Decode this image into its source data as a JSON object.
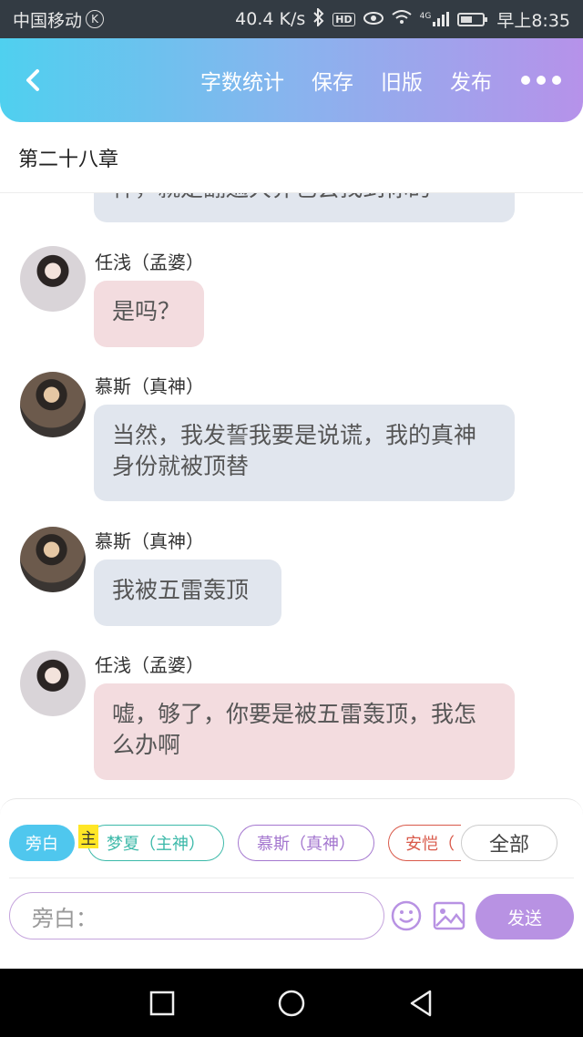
{
  "status_bar": {
    "carrier": "中国移动",
    "speed": "40.4 K/s",
    "network": "4G",
    "time": "早上8:35",
    "hd_badge": "HD",
    "icons": [
      "k-badge-icon",
      "bluetooth-icon",
      "hd-icon",
      "eye-icon",
      "wifi-icon",
      "signal-icon",
      "battery-icon"
    ]
  },
  "header": {
    "actions": [
      "字数统计",
      "保存",
      "旧版",
      "发布"
    ],
    "gradient_colors": [
      "#4fd0ef",
      "#b692ea"
    ]
  },
  "chapter": {
    "title": "第二十八章"
  },
  "messages": [
    {
      "speaker": "",
      "text": "神，就是翻遍大界也会找到你的",
      "style": "blue",
      "partial": true
    },
    {
      "speaker": "任浅（孟婆）",
      "text": "是吗？",
      "style": "pink",
      "avatar": "girl-avatar"
    },
    {
      "speaker": "慕斯（真神）",
      "text": "当然，我发誓我要是说谎，我的真神身份就被顶替",
      "style": "blue",
      "avatar": "boy-avatar"
    },
    {
      "speaker": "慕斯（真神）",
      "text": "我被五雷轰顶",
      "style": "blue",
      "avatar": "boy-avatar"
    },
    {
      "speaker": "任浅（孟婆）",
      "text": "嘘，够了，你要是被五雷轰顶，我怎么办啊",
      "style": "pink",
      "avatar": "girl-avatar"
    }
  ],
  "roles": {
    "narrator": "旁白",
    "main_tag": "主",
    "chips": [
      "梦夏（主神）",
      "慕斯（真神）",
      "安恺（"
    ],
    "all": "全部"
  },
  "composer": {
    "placeholder": "旁白：",
    "send": "发送"
  },
  "colors": {
    "accent_blue": "#4fc7ee",
    "accent_purple": "#b892e3",
    "bubble_blue": "#e1e6ee",
    "bubble_pink": "#f3dcdf"
  }
}
